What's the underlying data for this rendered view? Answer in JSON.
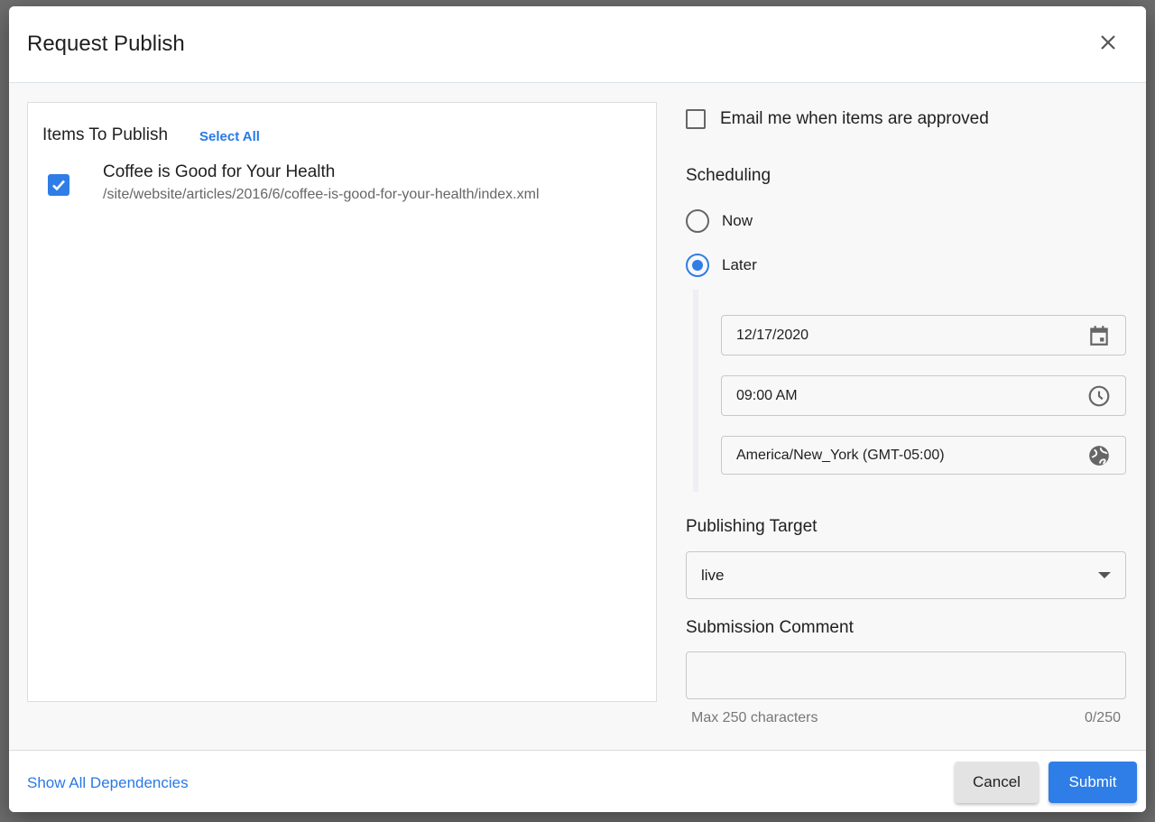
{
  "dialog": {
    "title": "Request Publish"
  },
  "items": {
    "heading": "Items To Publish",
    "select_all": "Select All",
    "list": [
      {
        "title": "Coffee is Good for Your Health",
        "path": "/site/website/articles/2016/6/coffee-is-good-for-your-health/index.xml",
        "checked": true
      }
    ]
  },
  "email": {
    "label": "Email me when items are approved",
    "checked": false
  },
  "scheduling": {
    "label": "Scheduling",
    "now": "Now",
    "later": "Later",
    "selected": "Later",
    "date": "12/17/2020",
    "time": "09:00 AM",
    "timezone": "America/New_York (GMT-05:00)"
  },
  "target": {
    "label": "Publishing Target",
    "value": "live"
  },
  "comment": {
    "label": "Submission Comment",
    "value": "",
    "helper": "Max 250 characters",
    "count": "0/250"
  },
  "footer": {
    "show_deps": "Show All Dependencies",
    "cancel": "Cancel",
    "submit": "Submit"
  }
}
